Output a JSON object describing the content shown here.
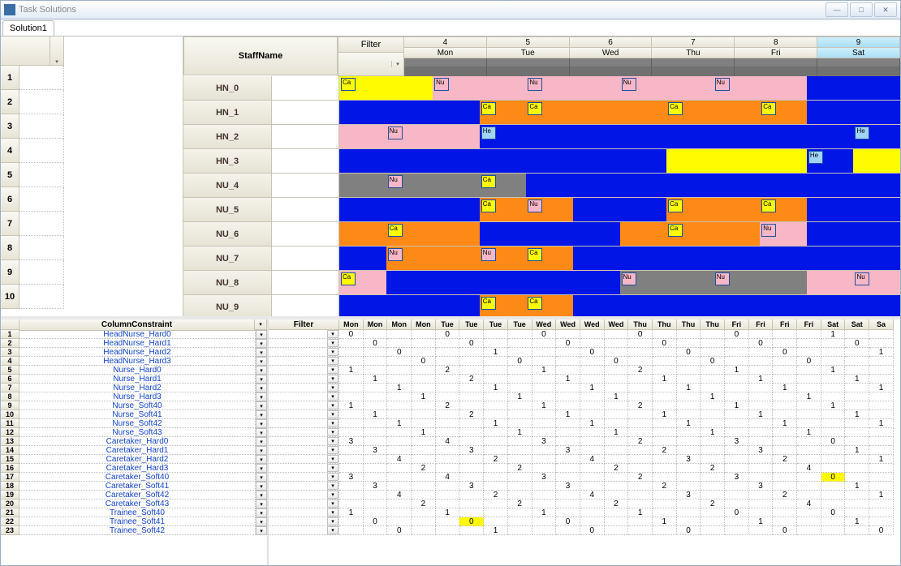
{
  "window": {
    "title": "Task Solutions"
  },
  "tab": {
    "label": "Solution1"
  },
  "staff_header": "StaffName",
  "filter_label": "Filter",
  "days": [
    {
      "num": "4",
      "name": "Mon"
    },
    {
      "num": "5",
      "name": "Tue"
    },
    {
      "num": "6",
      "name": "Wed"
    },
    {
      "num": "7",
      "name": "Thu"
    },
    {
      "num": "8",
      "name": "Fri"
    },
    {
      "num": "9",
      "name": "Sat",
      "sat": true
    }
  ],
  "staff_rows": [
    {
      "n": "1",
      "name": "HN_0",
      "segs": [
        {
          "l": "yellow",
          "r": "yellow",
          "tag": {
            "pos": "l",
            "c": "ye",
            "t": "Ca"
          }
        },
        {
          "l": "pink",
          "r": "pink",
          "tag": {
            "pos": "l",
            "c": "pk",
            "t": "Nu"
          }
        },
        {
          "l": "pink",
          "r": "pink",
          "tag": {
            "pos": "l",
            "c": "pk",
            "t": "Nu"
          }
        },
        {
          "l": "pink",
          "r": "pink",
          "tag": {
            "pos": "l",
            "c": "pk",
            "t": "Nu"
          }
        },
        {
          "l": "pink",
          "r": "pink",
          "tag": {
            "pos": "l",
            "c": "pk",
            "t": "Nu"
          }
        },
        {
          "l": "blue",
          "r": "blue"
        }
      ]
    },
    {
      "n": "2",
      "name": "HN_1",
      "segs": [
        {
          "l": "blue",
          "r": "blue"
        },
        {
          "l": "blue",
          "r": "orange",
          "tag": {
            "pos": "r",
            "c": "ye",
            "t": "Ca"
          }
        },
        {
          "l": "orange",
          "r": "orange",
          "tag": {
            "pos": "l",
            "c": "ye",
            "t": "Ca"
          }
        },
        {
          "l": "orange",
          "r": "orange",
          "tag": {
            "pos": "r",
            "c": "ye",
            "t": "Ca"
          }
        },
        {
          "l": "orange",
          "r": "orange",
          "tag": {
            "pos": "r",
            "c": "ye",
            "t": "Ca"
          }
        },
        {
          "l": "blue",
          "r": "blue"
        }
      ]
    },
    {
      "n": "3",
      "name": "HN_2",
      "segs": [
        {
          "l": "pink",
          "r": "pink",
          "tag": {
            "pos": "r",
            "c": "pk",
            "t": "Nu"
          }
        },
        {
          "l": "pink",
          "r": "blue",
          "tag": {
            "pos": "r",
            "c": "bl",
            "t": "He"
          }
        },
        {
          "l": "blue",
          "r": "blue"
        },
        {
          "l": "blue",
          "r": "blue"
        },
        {
          "l": "blue",
          "r": "blue"
        },
        {
          "l": "blue",
          "r": "blue",
          "tag": {
            "pos": "r",
            "c": "bl",
            "t": "He"
          }
        }
      ]
    },
    {
      "n": "4",
      "name": "HN_3",
      "segs": [
        {
          "l": "blue",
          "r": "blue"
        },
        {
          "l": "blue",
          "r": "blue"
        },
        {
          "l": "blue",
          "r": "blue"
        },
        {
          "l": "blue",
          "r": "yellow"
        },
        {
          "l": "yellow",
          "r": "yellow"
        },
        {
          "l": "blue",
          "r": "yellow",
          "tag": {
            "pos": "l",
            "c": "bl",
            "t": "He"
          }
        }
      ]
    },
    {
      "n": "5",
      "name": "NU_4",
      "segs": [
        {
          "l": "gray",
          "r": "gray",
          "tag": {
            "pos": "r",
            "c": "pk",
            "t": "Nu"
          }
        },
        {
          "l": "gray",
          "r": "gray",
          "tag": {
            "pos": "r",
            "c": "ye",
            "t": "Ca"
          }
        },
        {
          "l": "blue",
          "r": "blue"
        },
        {
          "l": "blue",
          "r": "blue"
        },
        {
          "l": "blue",
          "r": "blue"
        },
        {
          "l": "blue",
          "r": "blue"
        }
      ]
    },
    {
      "n": "6",
      "name": "NU_5",
      "segs": [
        {
          "l": "blue",
          "r": "blue"
        },
        {
          "l": "blue",
          "r": "orange",
          "tag": {
            "pos": "r",
            "c": "ye",
            "t": "Ca"
          }
        },
        {
          "l": "orange",
          "r": "blue",
          "tag": {
            "pos": "l",
            "c": "pk",
            "t": "Nu"
          }
        },
        {
          "l": "blue",
          "r": "orange",
          "tag": {
            "pos": "r",
            "c": "ye",
            "t": "Ca"
          }
        },
        {
          "l": "orange",
          "r": "orange",
          "tag": {
            "pos": "r",
            "c": "ye",
            "t": "Ca"
          }
        },
        {
          "l": "blue",
          "r": "blue"
        }
      ]
    },
    {
      "n": "7",
      "name": "NU_6",
      "segs": [
        {
          "l": "orange",
          "r": "orange",
          "tag": {
            "pos": "r",
            "c": "ye",
            "t": "Ca"
          }
        },
        {
          "l": "orange",
          "r": "blue"
        },
        {
          "l": "blue",
          "r": "blue"
        },
        {
          "l": "orange",
          "r": "orange",
          "tag": {
            "pos": "r",
            "c": "ye",
            "t": "Ca"
          }
        },
        {
          "l": "orange",
          "r": "pink",
          "tag": {
            "pos": "r",
            "c": "pk",
            "t": "Nu"
          }
        },
        {
          "l": "blue",
          "r": "blue"
        }
      ]
    },
    {
      "n": "8",
      "name": "NU_7",
      "segs": [
        {
          "l": "blue",
          "r": "orange",
          "tag": {
            "pos": "r",
            "c": "pk",
            "t": "Nu"
          }
        },
        {
          "l": "orange",
          "r": "orange",
          "tag": {
            "pos": "r",
            "c": "pk",
            "t": "Nu"
          }
        },
        {
          "l": "orange",
          "r": "blue",
          "tag": {
            "pos": "l",
            "c": "ye",
            "t": "Ca"
          }
        },
        {
          "l": "blue",
          "r": "blue"
        },
        {
          "l": "blue",
          "r": "blue"
        },
        {
          "l": "blue",
          "r": "blue"
        }
      ]
    },
    {
      "n": "9",
      "name": "NU_8",
      "segs": [
        {
          "l": "pink",
          "r": "blue",
          "tag": {
            "pos": "l",
            "c": "ye",
            "t": "Ca"
          }
        },
        {
          "l": "blue",
          "r": "blue"
        },
        {
          "l": "blue",
          "r": "blue"
        },
        {
          "l": "gray",
          "r": "gray",
          "tag": {
            "pos": "l",
            "c": "pk",
            "t": "Nu"
          }
        },
        {
          "l": "gray",
          "r": "gray",
          "tag": {
            "pos": "l",
            "c": "pk",
            "t": "Nu"
          }
        },
        {
          "l": "pink",
          "r": "pink",
          "tag": {
            "pos": "r",
            "c": "pk",
            "t": "Nu"
          }
        }
      ]
    },
    {
      "n": "10",
      "name": "NU_9",
      "segs": [
        {
          "l": "blue",
          "r": "blue"
        },
        {
          "l": "blue",
          "r": "orange",
          "tag": {
            "pos": "r",
            "c": "ye",
            "t": "Ca"
          }
        },
        {
          "l": "orange",
          "r": "blue",
          "tag": {
            "pos": "l",
            "c": "ye",
            "t": "Ca"
          }
        },
        {
          "l": "blue",
          "r": "blue"
        },
        {
          "l": "blue",
          "r": "blue"
        },
        {
          "l": "blue",
          "r": "blue"
        }
      ]
    }
  ],
  "bottom": {
    "column_constraint_label": "ColumnConstraint",
    "filter_label": "Filter",
    "day_headers": [
      "Mon",
      "Mon",
      "Mon",
      "Mon",
      "Tue",
      "Tue",
      "Tue",
      "Tue",
      "Wed",
      "Wed",
      "Wed",
      "Wed",
      "Thu",
      "Thu",
      "Thu",
      "Thu",
      "Fri",
      "Fri",
      "Fri",
      "Fri",
      "Sat",
      "Sat",
      "Sa"
    ],
    "rows": [
      {
        "n": "1",
        "name": "HeadNurse_Hard0",
        "v": {
          "0": "0",
          "4": "0",
          "8": "0",
          "12": "0",
          "16": "0",
          "20": "1"
        }
      },
      {
        "n": "2",
        "name": "HeadNurse_Hard1",
        "v": {
          "1": "0",
          "5": "0",
          "9": "0",
          "13": "0",
          "17": "0",
          "21": "0"
        }
      },
      {
        "n": "3",
        "name": "HeadNurse_Hard2",
        "v": {
          "2": "0",
          "6": "1",
          "10": "0",
          "14": "0",
          "18": "0",
          "22": "1"
        }
      },
      {
        "n": "4",
        "name": "HeadNurse_Hard3",
        "v": {
          "3": "0",
          "7": "0",
          "11": "0",
          "15": "0",
          "19": "0"
        }
      },
      {
        "n": "5",
        "name": "Nurse_Hard0",
        "v": {
          "0": "1",
          "4": "2",
          "8": "1",
          "12": "2",
          "16": "1",
          "20": "1"
        }
      },
      {
        "n": "6",
        "name": "Nurse_Hard1",
        "v": {
          "1": "1",
          "5": "2",
          "9": "1",
          "13": "1",
          "17": "1",
          "21": "1"
        }
      },
      {
        "n": "7",
        "name": "Nurse_Hard2",
        "v": {
          "2": "1",
          "6": "1",
          "10": "1",
          "14": "1",
          "18": "1",
          "22": "1"
        }
      },
      {
        "n": "8",
        "name": "Nurse_Hard3",
        "v": {
          "3": "1",
          "7": "1",
          "11": "1",
          "15": "1",
          "19": "1"
        }
      },
      {
        "n": "9",
        "name": "Nurse_Soft40",
        "v": {
          "0": "1",
          "4": "2",
          "8": "1",
          "12": "2",
          "16": "1",
          "20": "1"
        }
      },
      {
        "n": "10",
        "name": "Nurse_Soft41",
        "v": {
          "1": "1",
          "5": "2",
          "9": "1",
          "13": "1",
          "17": "1",
          "21": "1"
        }
      },
      {
        "n": "11",
        "name": "Nurse_Soft42",
        "v": {
          "2": "1",
          "6": "1",
          "10": "1",
          "14": "1",
          "18": "1",
          "22": "1"
        }
      },
      {
        "n": "12",
        "name": "Nurse_Soft43",
        "v": {
          "3": "1",
          "7": "1",
          "11": "1",
          "15": "1",
          "19": "1"
        }
      },
      {
        "n": "13",
        "name": "Caretaker_Hard0",
        "v": {
          "0": "3",
          "4": "4",
          "8": "3",
          "12": "2",
          "16": "3",
          "20": "0"
        }
      },
      {
        "n": "14",
        "name": "Caretaker_Hard1",
        "v": {
          "1": "3",
          "5": "3",
          "9": "3",
          "13": "2",
          "17": "3",
          "21": "1"
        }
      },
      {
        "n": "15",
        "name": "Caretaker_Hard2",
        "v": {
          "2": "4",
          "6": "2",
          "10": "4",
          "14": "3",
          "18": "2",
          "22": "1"
        }
      },
      {
        "n": "16",
        "name": "Caretaker_Hard3",
        "v": {
          "3": "2",
          "7": "2",
          "11": "2",
          "15": "2",
          "19": "4"
        }
      },
      {
        "n": "17",
        "name": "Caretaker_Soft40",
        "v": {
          "0": "3",
          "4": "4",
          "8": "3",
          "12": "2",
          "16": "3",
          "20": "0"
        },
        "hl": {
          "20": true
        }
      },
      {
        "n": "18",
        "name": "Caretaker_Soft41",
        "v": {
          "1": "3",
          "5": "3",
          "9": "3",
          "13": "2",
          "17": "3",
          "21": "1"
        }
      },
      {
        "n": "19",
        "name": "Caretaker_Soft42",
        "v": {
          "2": "4",
          "6": "2",
          "10": "4",
          "14": "3",
          "18": "2",
          "22": "1"
        }
      },
      {
        "n": "20",
        "name": "Caretaker_Soft43",
        "v": {
          "3": "2",
          "7": "2",
          "11": "2",
          "15": "2",
          "19": "4"
        }
      },
      {
        "n": "21",
        "name": "Trainee_Soft40",
        "v": {
          "0": "1",
          "4": "1",
          "8": "1",
          "12": "1",
          "16": "0",
          "20": "0"
        }
      },
      {
        "n": "22",
        "name": "Trainee_Soft41",
        "v": {
          "1": "0",
          "5": "0",
          "9": "0",
          "13": "1",
          "17": "1",
          "21": "1"
        },
        "hl": {
          "5": true
        }
      },
      {
        "n": "23",
        "name": "Trainee_Soft42",
        "v": {
          "2": "0",
          "6": "1",
          "10": "0",
          "14": "0",
          "18": "0",
          "22": "0"
        }
      }
    ]
  }
}
